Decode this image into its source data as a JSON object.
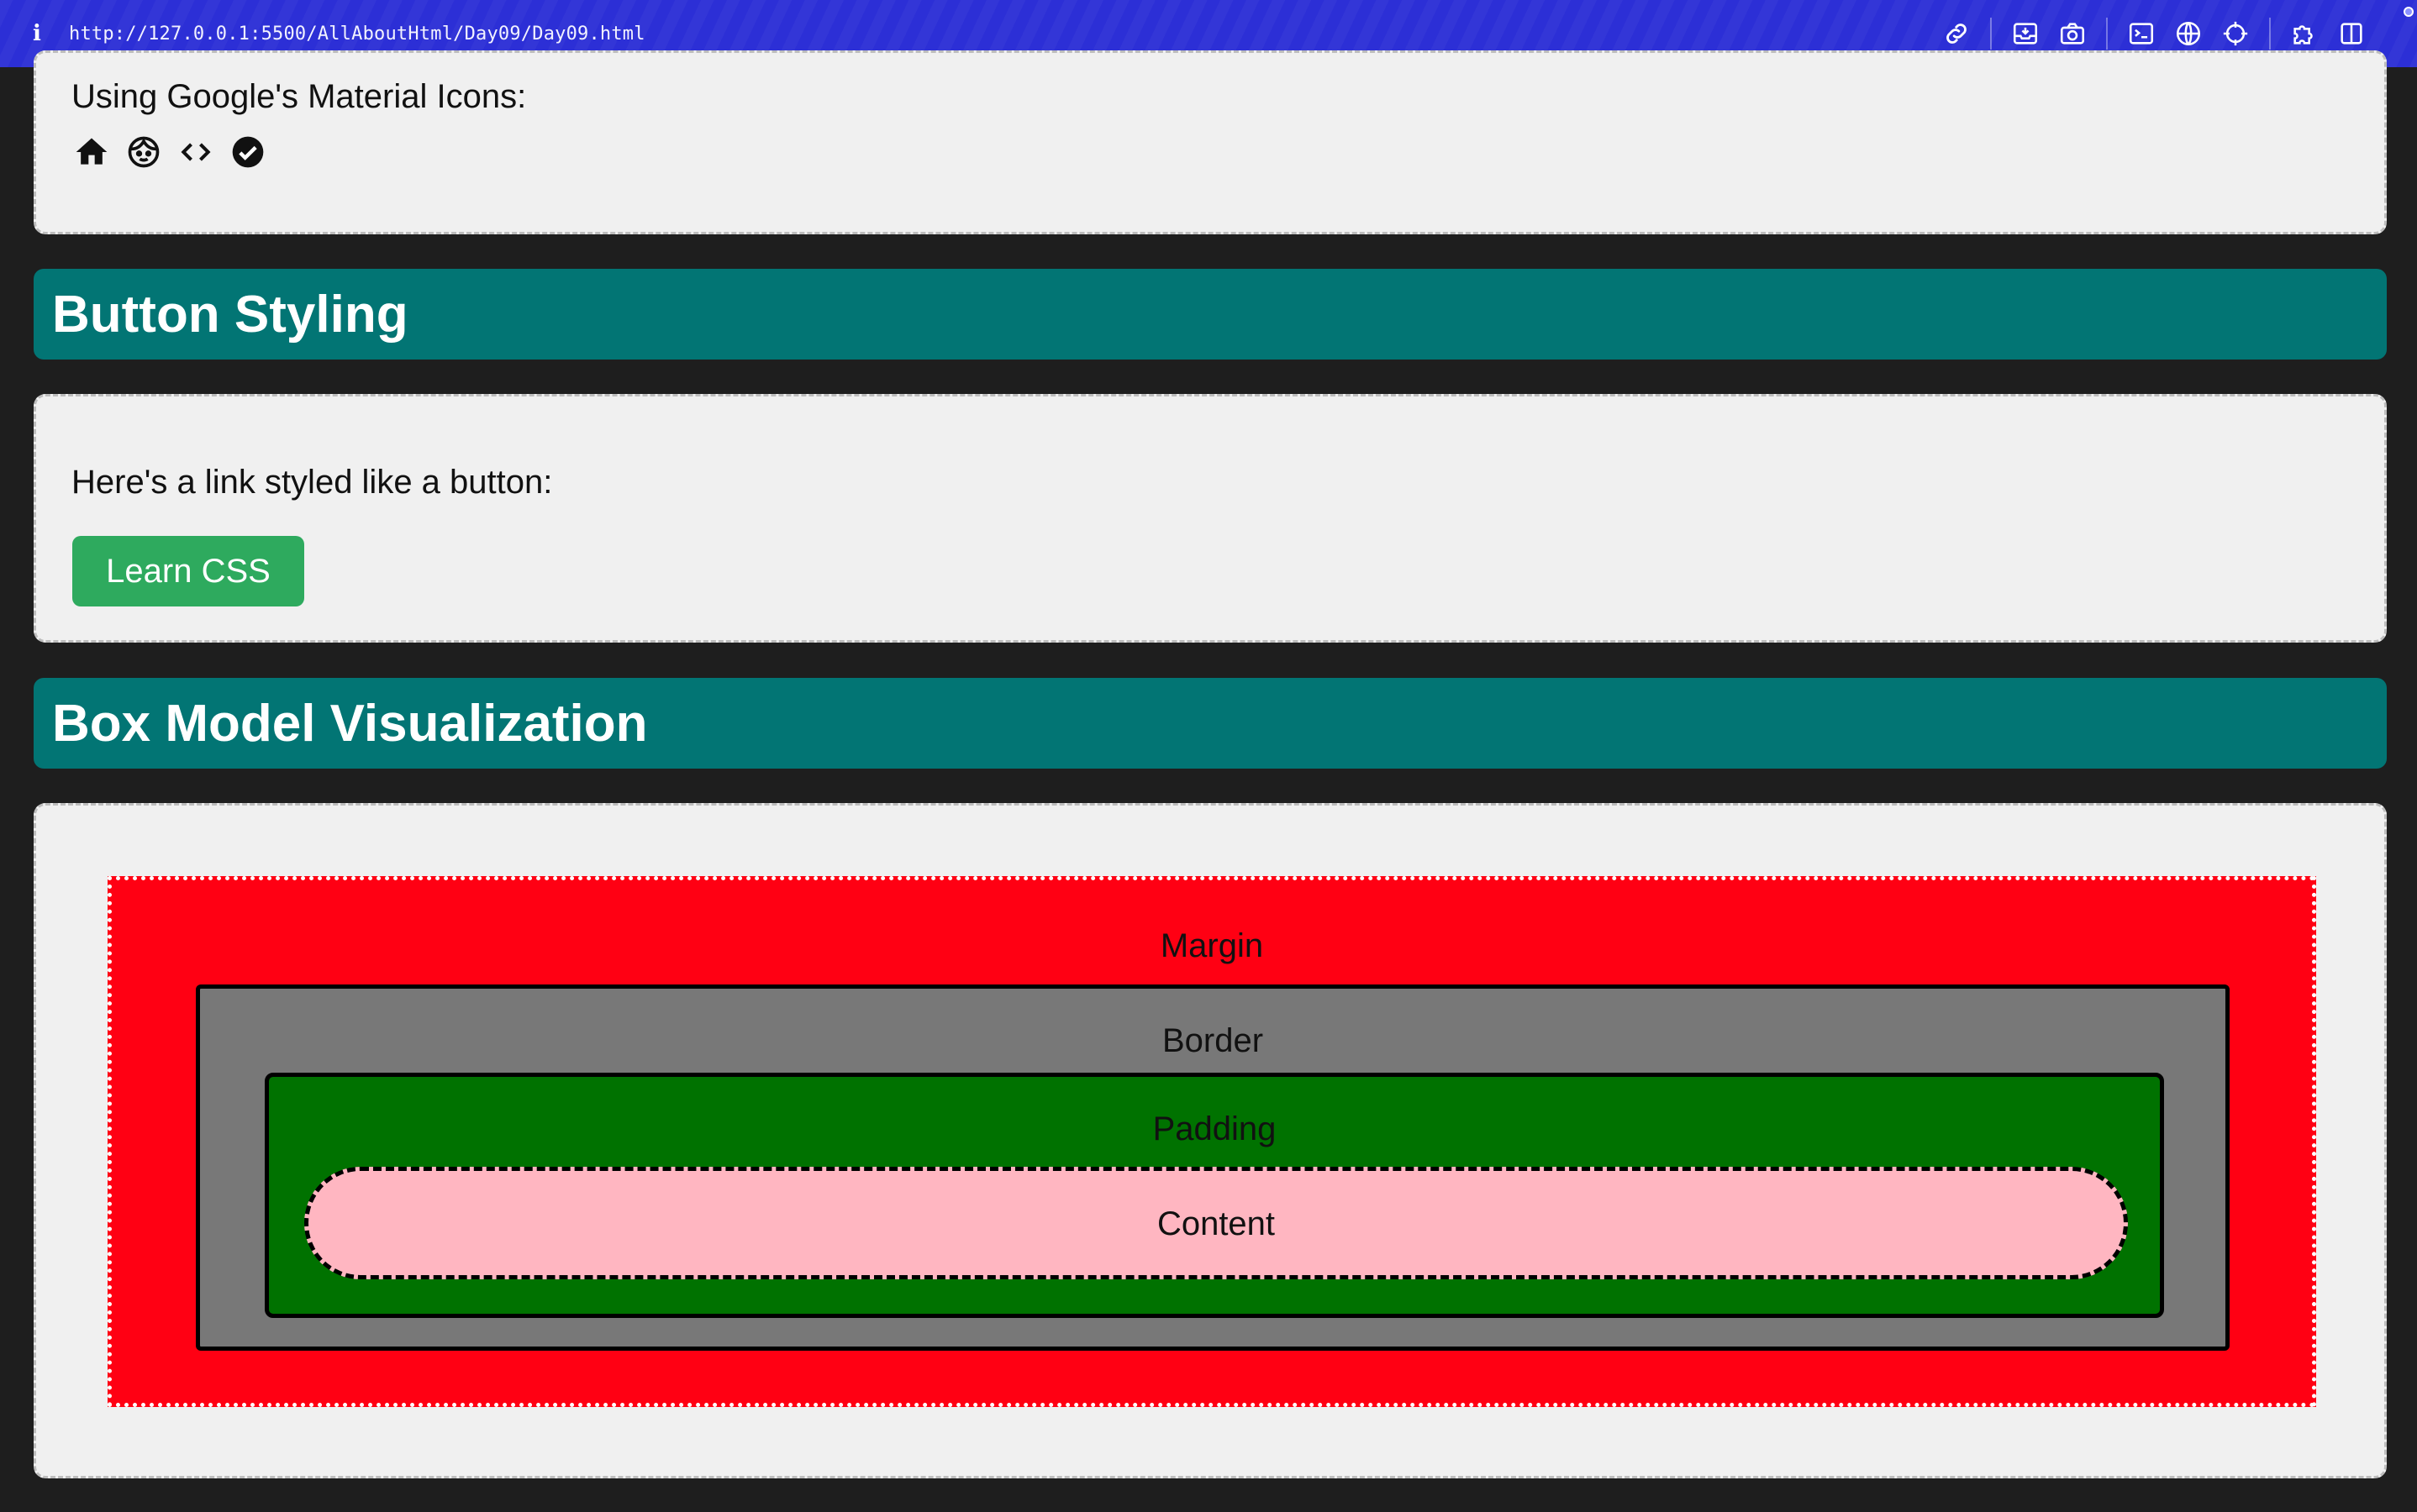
{
  "browser": {
    "url": "http://127.0.0.1:5500/AllAboutHtml/Day09/Day09.html",
    "info_icon": "info-icon",
    "toolbar_icons": [
      "link-icon",
      "inbox-icon",
      "camera-icon",
      "terminal-icon",
      "globe-icon",
      "crosshair-icon",
      "puzzle-icon",
      "sidebar-icon"
    ],
    "accent_color": "#2c2fd6"
  },
  "icons_section": {
    "label": "Using Google's Material Icons:",
    "icons": [
      "home-icon",
      "face-icon",
      "code-icon",
      "check-circle-icon"
    ]
  },
  "button_section": {
    "heading": "Button Styling",
    "label": "Here's a link styled like a button:",
    "button_label": "Learn CSS",
    "button_color": "#2eaa5e"
  },
  "box_model_section": {
    "heading": "Box Model Visualization",
    "heading_color": "#027574",
    "layers": {
      "margin": {
        "label": "Margin",
        "color": "#ff0013"
      },
      "border": {
        "label": "Border",
        "color": "#787878"
      },
      "padding": {
        "label": "Padding",
        "color": "#007200"
      },
      "content": {
        "label": "Content",
        "color": "#ffb6c1"
      }
    }
  }
}
